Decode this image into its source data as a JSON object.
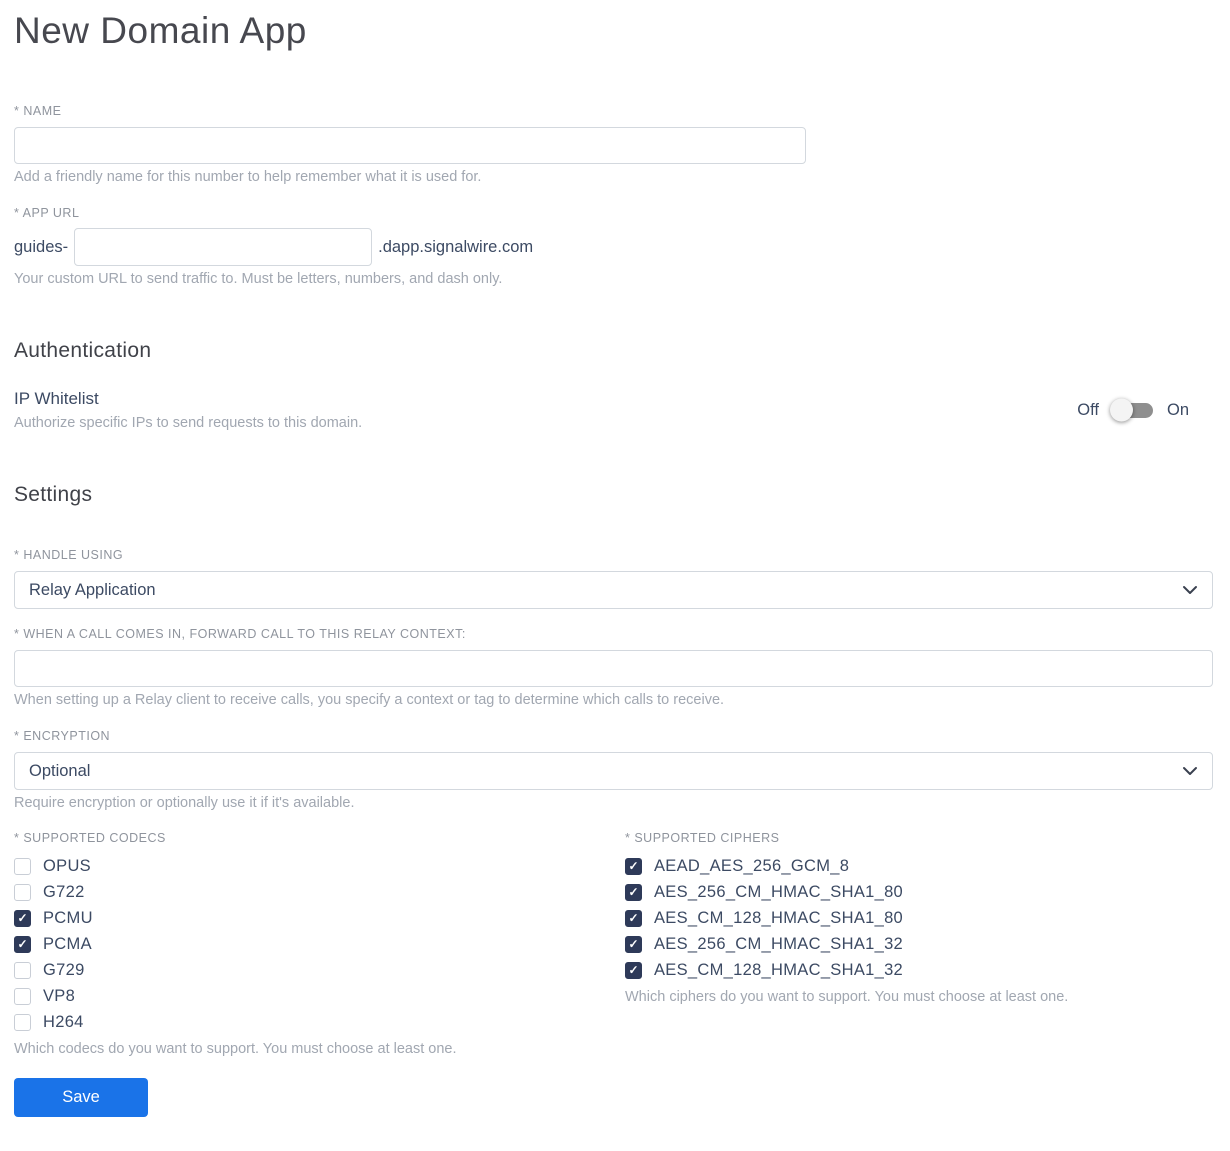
{
  "page": {
    "title": "New Domain App"
  },
  "name_field": {
    "label": "* NAME",
    "value": "",
    "helper": "Add a friendly name for this number to help remember what it is used for."
  },
  "app_url_field": {
    "label": "* APP URL",
    "prefix": "guides-",
    "value": "",
    "suffix": ".dapp.signalwire.com",
    "helper": "Your custom URL to send traffic to. Must be letters, numbers, and dash only."
  },
  "authentication": {
    "heading": "Authentication",
    "ip_whitelist": {
      "label": "IP Whitelist",
      "description": "Authorize specific IPs to send requests to this domain.",
      "off_label": "Off",
      "on_label": "On",
      "state": "off"
    }
  },
  "settings": {
    "heading": "Settings",
    "handle_using": {
      "label": "* HANDLE USING",
      "selected": "Relay Application"
    },
    "relay_context": {
      "label": "* WHEN A CALL COMES IN, FORWARD CALL TO THIS RELAY CONTEXT:",
      "value": "",
      "helper": "When setting up a Relay client to receive calls, you specify a context or tag to determine which calls to receive."
    },
    "encryption": {
      "label": "* ENCRYPTION",
      "selected": "Optional",
      "helper": "Require encryption or optionally use it if it's available."
    },
    "codecs": {
      "label": "* SUPPORTED CODECS",
      "helper": "Which codecs do you want to support. You must choose at least one.",
      "items": [
        {
          "label": "OPUS",
          "checked": false
        },
        {
          "label": "G722",
          "checked": false
        },
        {
          "label": "PCMU",
          "checked": true
        },
        {
          "label": "PCMA",
          "checked": true
        },
        {
          "label": "G729",
          "checked": false
        },
        {
          "label": "VP8",
          "checked": false
        },
        {
          "label": "H264",
          "checked": false
        }
      ]
    },
    "ciphers": {
      "label": "* SUPPORTED CIPHERS",
      "helper": "Which ciphers do you want to support. You must choose at least one.",
      "items": [
        {
          "label": "AEAD_AES_256_GCM_8",
          "checked": true
        },
        {
          "label": "AES_256_CM_HMAC_SHA1_80",
          "checked": true
        },
        {
          "label": "AES_CM_128_HMAC_SHA1_80",
          "checked": true
        },
        {
          "label": "AES_256_CM_HMAC_SHA1_32",
          "checked": true
        },
        {
          "label": "AES_CM_128_HMAC_SHA1_32",
          "checked": true
        }
      ]
    }
  },
  "save_button": {
    "label": "Save"
  },
  "colors": {
    "accent_blue": "#1a73e8",
    "checkbox_checked": "#2e3a59",
    "text_dark": "#3c4a63",
    "text_muted": "#a1a7b1",
    "label_gray": "#8f949d",
    "border": "#d3d8de",
    "toggle_track": "#8f8f8f"
  }
}
